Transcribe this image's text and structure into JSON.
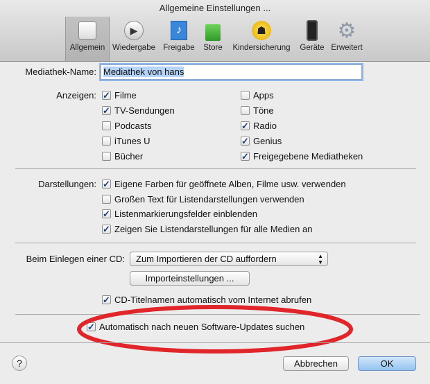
{
  "window": {
    "title": "Allgemeine Einstellungen ..."
  },
  "toolbar": [
    {
      "label": "Allgemein",
      "icon": "switch-icon",
      "selected": true
    },
    {
      "label": "Wiedergabe",
      "icon": "play-icon"
    },
    {
      "label": "Freigabe",
      "icon": "shared-music-icon"
    },
    {
      "label": "Store",
      "icon": "shopping-bag-icon"
    },
    {
      "label": "Kindersicherung",
      "icon": "parental-control-icon"
    },
    {
      "label": "Geräte",
      "icon": "iphone-icon"
    },
    {
      "label": "Erweitert",
      "icon": "gear-icon"
    }
  ],
  "library": {
    "label": "Mediathek-Name:",
    "value": "Mediathek von hans"
  },
  "show": {
    "label": "Anzeigen:",
    "items": [
      {
        "label": "Filme",
        "checked": true
      },
      {
        "label": "TV-Sendungen",
        "checked": true
      },
      {
        "label": "Podcasts",
        "checked": false
      },
      {
        "label": "iTunes U",
        "checked": false
      },
      {
        "label": "Bücher",
        "checked": false
      },
      {
        "label": "Apps",
        "checked": false
      },
      {
        "label": "Töne",
        "checked": false
      },
      {
        "label": "Radio",
        "checked": true
      },
      {
        "label": "Genius",
        "checked": true
      },
      {
        "label": "Freigegebene Mediatheken",
        "checked": true
      }
    ]
  },
  "views": {
    "label": "Darstellungen:",
    "items": [
      {
        "label": "Eigene Farben für geöffnete Alben, Filme usw. verwenden",
        "checked": true
      },
      {
        "label": "Großen Text für Listendarstellungen verwenden",
        "checked": false
      },
      {
        "label": "Listenmarkierungsfelder einblenden",
        "checked": true
      },
      {
        "label": "Zeigen Sie Listendarstellungen für alle Medien an",
        "checked": true
      }
    ]
  },
  "cd": {
    "label": "Beim Einlegen einer CD:",
    "select": "Zum Importieren der CD auffordern",
    "import_button": "Importeinstellungen ...",
    "fetch": {
      "label": "CD-Titelnamen automatisch vom Internet abrufen",
      "checked": true
    }
  },
  "updates": {
    "label": "Automatisch nach neuen Software-Updates suchen",
    "checked": true
  },
  "buttons": {
    "help": "?",
    "cancel": "Abbrechen",
    "ok": "OK"
  },
  "annotation_color": "#e0262a"
}
